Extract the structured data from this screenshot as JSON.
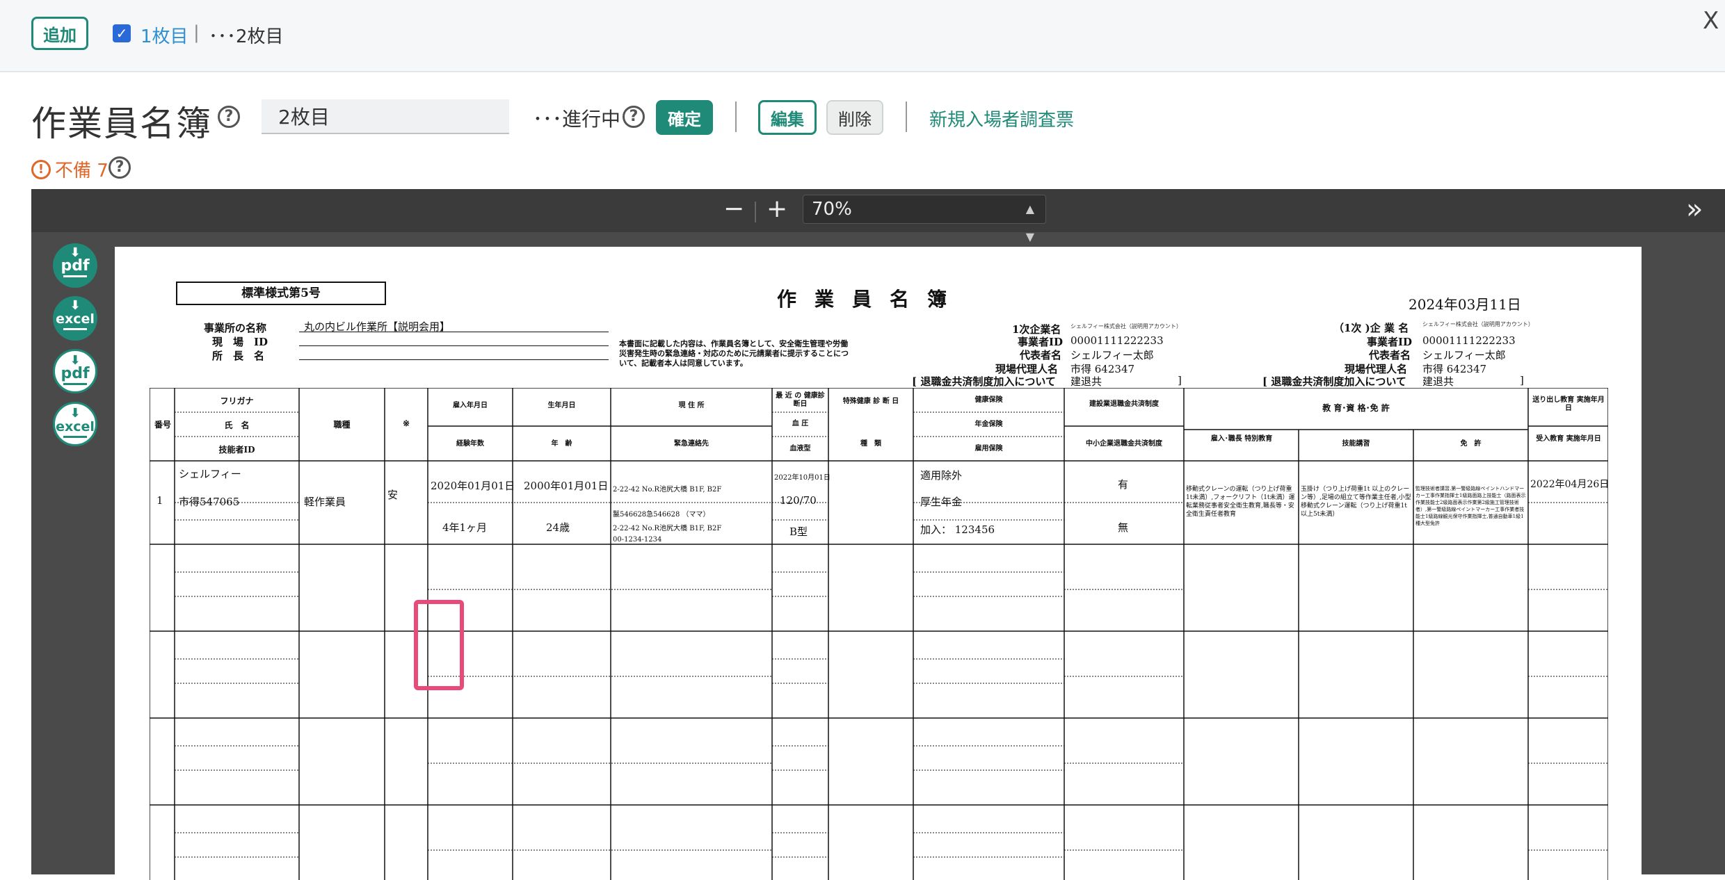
{
  "topbar": {
    "add_label": "追加",
    "sheet1": "1枚目",
    "sep": "|",
    "sheet2": "･･･2枚目",
    "close": "X"
  },
  "header": {
    "title": "作業員名簿",
    "name_value": "2枚目",
    "status": "･･･進行中",
    "confirm_label": "確定",
    "edit_label": "編集",
    "delete_label": "削除",
    "new_link": "新規入場者調査票",
    "warn_text": "不備 7",
    "warn_icon": "!",
    "help_icon": "?"
  },
  "viewer": {
    "zoom_minus": "−",
    "zoom_plus": "+",
    "zoom_value": "70%",
    "sidebar_toggle": "»",
    "downloads": [
      {
        "label": "pdf"
      },
      {
        "label": "excel"
      },
      {
        "label": "pdf"
      },
      {
        "label": "excel"
      }
    ]
  },
  "doc": {
    "form_no": "標準様式第5号",
    "title": "作業員名簿",
    "date": "2024年03月11日",
    "office_label": "事業所の名称",
    "office_value": "丸の内ビル作業所【説明会用】",
    "site_id_label": "現　場　ID",
    "foreman_label": "所　長　名",
    "notice": "本書面に記載した内容は、作業員名簿として、安全衛生管理や労働災害発生時の緊急連絡・対応のために元請業者に提示することについて、記載者本人は同意しています。",
    "primary": {
      "company_label": "1次企業名",
      "company_value": "シェルフィー株式会社（説明用アカウント）",
      "id_label": "事業者ID",
      "id_value": "00001111222233",
      "rep_label": "代表者名",
      "rep_value": "シェルフィー太郎",
      "agent_label": "現場代理人名",
      "agent_value": "市得 642347",
      "pension_label": "[ 退職金共済制度加入について",
      "pension_value": "建退共",
      "pension_close": "]"
    },
    "secondary": {
      "company_label": "（1次 )企 業 名",
      "company_value": "シェルフィー株式会社（説明用アカウント）",
      "id_label": "事業者ID",
      "id_value": "00001111222233",
      "rep_label": "代表者名",
      "rep_value": "シェルフィー太郎",
      "agent_label": "現場代理人名",
      "agent_value": "市得 642347",
      "pension_label": "[ 退職金共済制度加入について",
      "pension_value": "建退共",
      "pension_close": "]"
    },
    "headers": {
      "no": "番号",
      "furigana": "フリガナ",
      "name": "氏　名",
      "tech_id": "技能者ID",
      "job": "職種",
      "mark": "※",
      "hire_date": "雇入年月日",
      "years": "経験年数",
      "birth": "生年月日",
      "age": "年　齢",
      "address": "現 住 所",
      "emergency": "緊急連絡先",
      "checkup": "最 近 の 健康診断日",
      "bp": "血 圧",
      "blood": "血液型",
      "special": "特殊健康 診 断 日",
      "kind": "種　類",
      "health_ins": "健康保険",
      "pension_ins": "年金保険",
      "employ_ins": "雇用保険",
      "kentai": "建設業退職金共済制度",
      "chutai": "中小企業退職金共済制度",
      "edu": "教 育･資 格･免 許",
      "special_edu": "雇入･職長 特別教育",
      "skill": "技能講習",
      "license": "免　許",
      "dispatch_edu": "送り出し教育 実施年月日",
      "accept_edu": "受入教育 実施年月日"
    },
    "row1": {
      "no": "1",
      "furigana": "シェルフィー",
      "name": "市得547065",
      "job": "軽作業員",
      "mark": "安",
      "hire_date": "2020年01月01日",
      "years": "4年1ヶ月",
      "birth": "2000年01月01日",
      "age": "24歳",
      "address": "2-22-42 No.R池尻大橋 B1F, B2F",
      "emergency_name": "鬣546628急546628 （ママ）",
      "emergency_addr": "2-22-42 No.R池尻大橋 B1F, B2F",
      "emergency_tel": "00-1234-1234",
      "checkup": "2022年10月01日",
      "bp": "120/70",
      "blood": "B型",
      "health_ins": "適用除外",
      "pension_ins": "厚生年金",
      "employ_ins": "加入： 123456",
      "kentai": "有",
      "chutai": "無",
      "special_edu": "移動式クレーンの運転（つり上げ荷重1t未満）,フォークリフト（1t未満）運転業務従事者安全衛生教育,職長等・安全衛生責任者教育",
      "skill": "玉掛け（つり上げ荷重1t 以上のクレーン等）,足場の組立て等作業主任者,小型移動式クレーン運転（つり上げ荷重1t 以上5t未満）",
      "license": "監理技術者講習,第一警級路線ペイントハンドマーカー工事作業指揮士1級路面路上技能士（路面表示作業技能士2級路面表示作業第2級施工管理技術者）,第一警級路線ペイントマーカー工事作業者技能士1級路線観光保守作業指揮士,普通自動車1級1種大型免許",
      "dispatch_edu": "2022年04月26日"
    }
  }
}
